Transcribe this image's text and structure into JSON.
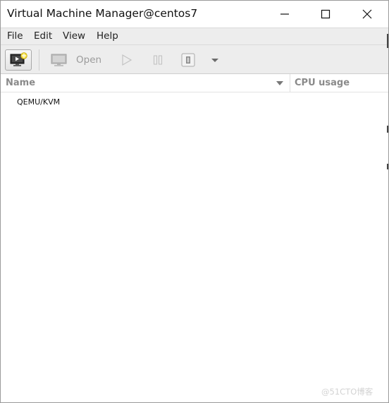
{
  "window": {
    "title": "Virtual Machine Manager@centos7"
  },
  "menu": {
    "items": [
      "File",
      "Edit",
      "View",
      "Help"
    ]
  },
  "toolbar": {
    "open_label": "Open"
  },
  "columns": {
    "name": "Name",
    "cpu": "CPU usage"
  },
  "connections": [
    {
      "name": "QEMU/KVM"
    }
  ],
  "watermark": "@51CTO博客",
  "icons": [
    "new-vm-icon",
    "monitor-icon",
    "play-icon",
    "pause-icon",
    "shutdown-icon",
    "chevron-down-icon",
    "minimize-icon",
    "maximize-icon",
    "close-icon",
    "sort-arrow-icon"
  ]
}
